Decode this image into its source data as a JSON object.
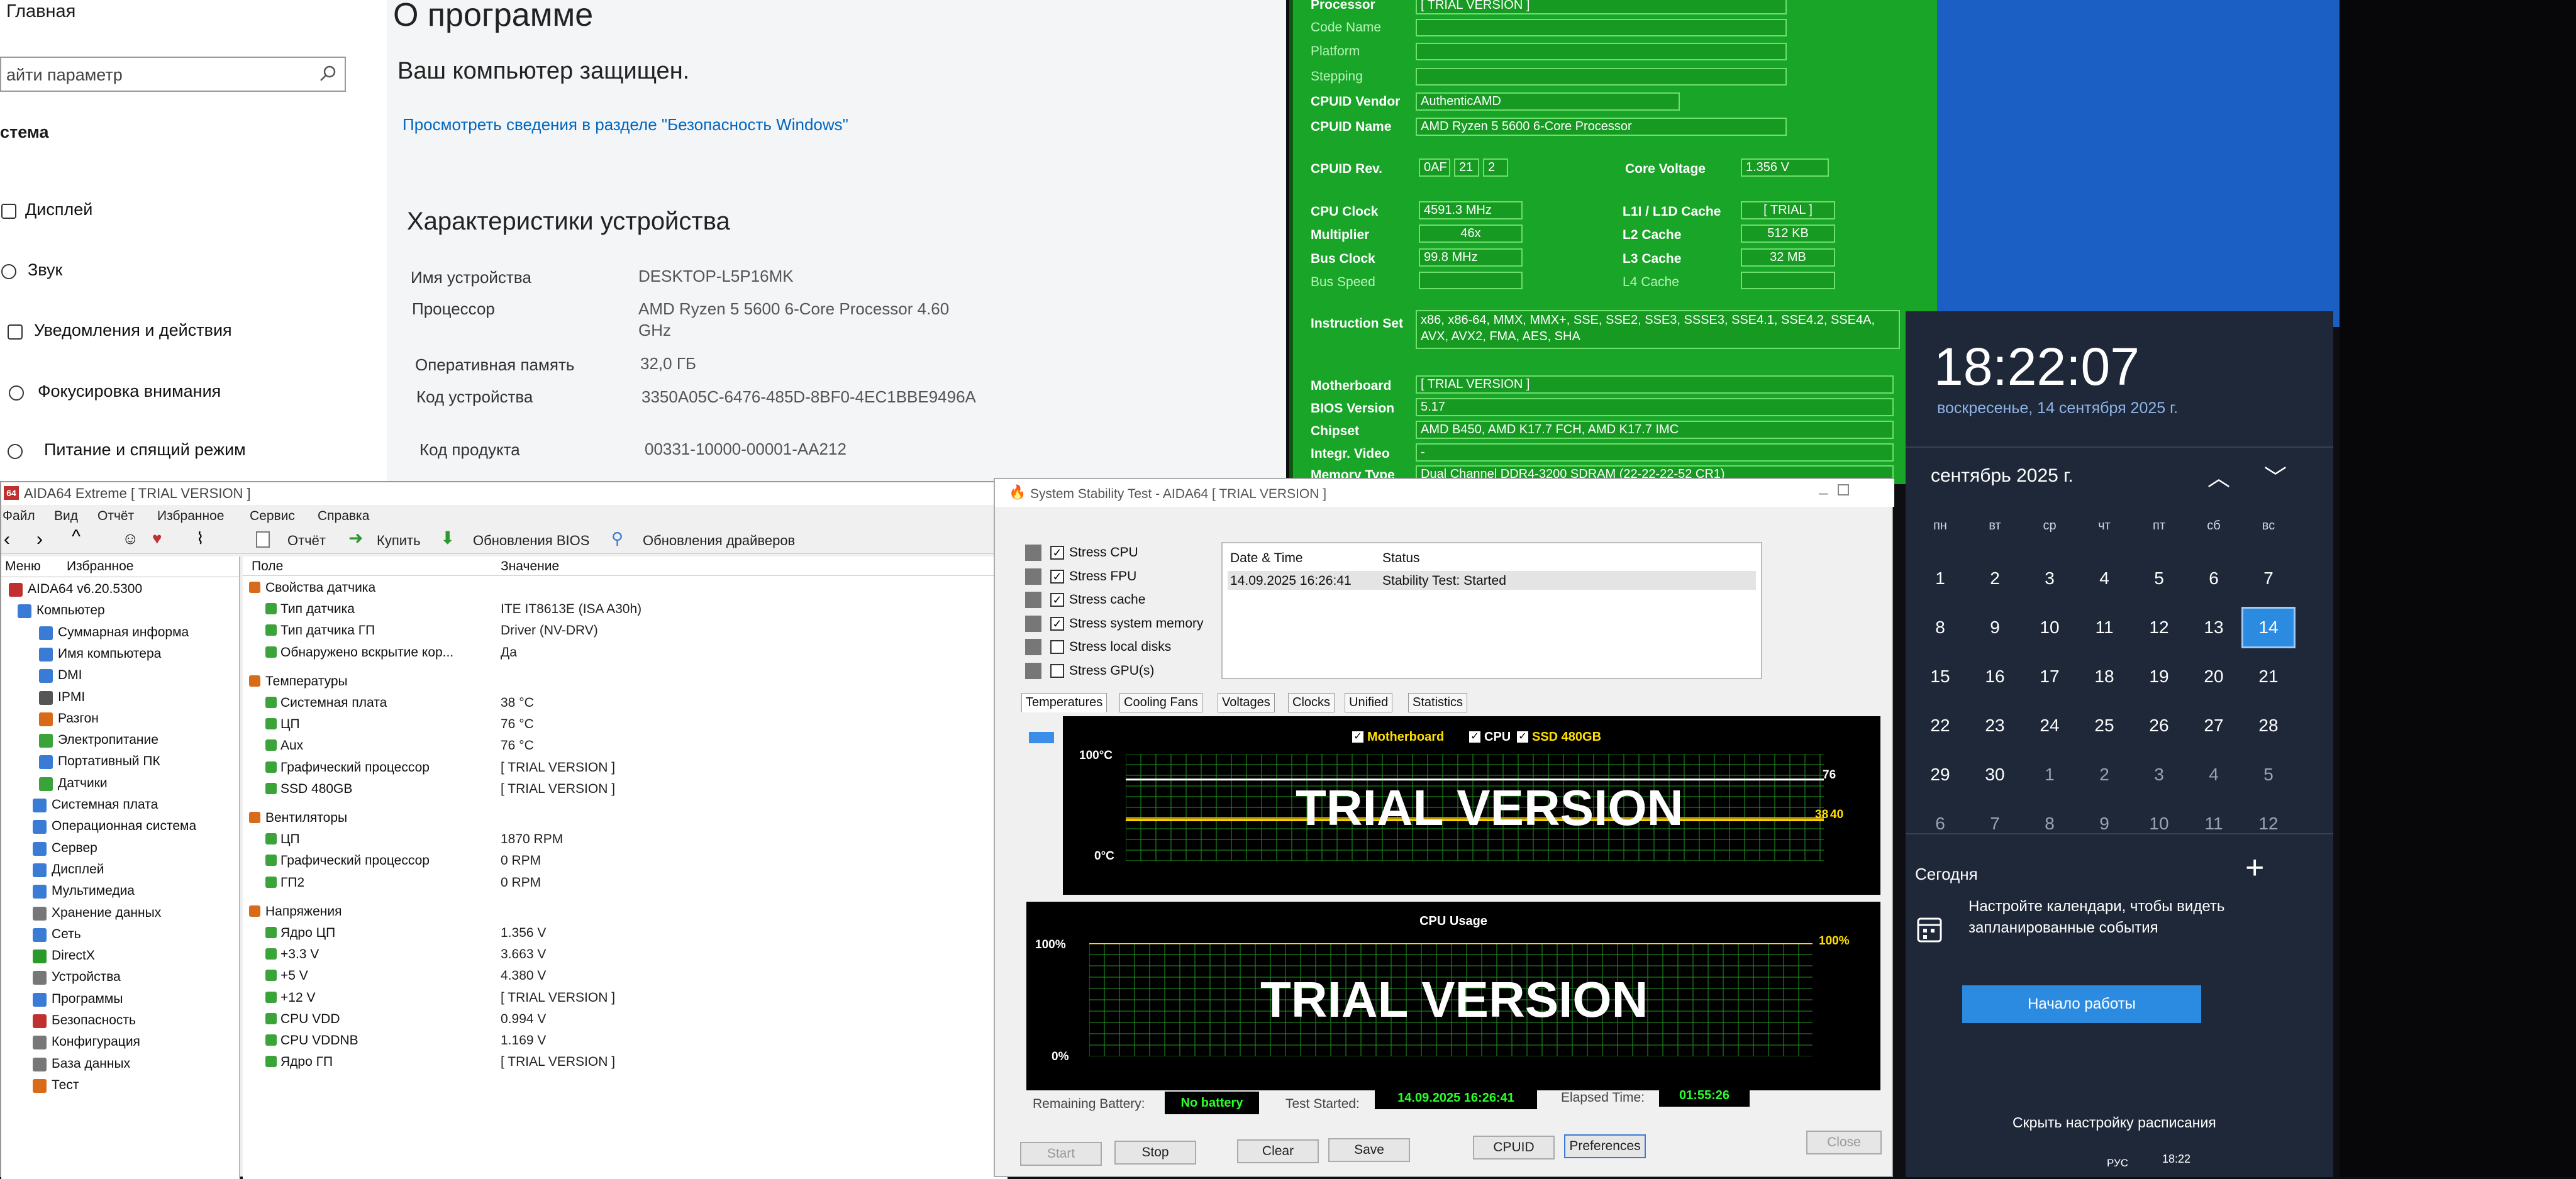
{
  "settings": {
    "nav_home": "Главная",
    "search_placeholder": "айти параметр",
    "section": "стема",
    "nav_items": [
      "Дисплей",
      "Звук",
      "Уведомления и действия",
      "Фокусировка внимания",
      "Питание и спящий режим"
    ],
    "title": "О программе",
    "protected": "Ваш компьютер защищен.",
    "link": "Просмотреть сведения в разделе \"Безопасность Windows\"",
    "specs_title": "Характеристики устройства",
    "specs": [
      {
        "label": "Имя устройства",
        "value": "DESKTOP-L5P16MK"
      },
      {
        "label": "Процессор",
        "value": "AMD Ryzen 5 5600 6-Core Processor 4.60 GHz"
      },
      {
        "label": "Оперативная память",
        "value": "32,0 ГБ"
      },
      {
        "label": "Код устройства",
        "value": "3350A05C-6476-485D-8BF0-4EC1BBE9496A"
      },
      {
        "label": "Код продукта",
        "value": "00331-10000-00001-AA212"
      }
    ]
  },
  "cpuz": {
    "processor_label": "Processor",
    "processor": "[ TRIAL VERSION ]",
    "code_name_label": "Code Name",
    "platform_label": "Platform",
    "stepping_label": "Stepping",
    "vendor_label": "CPUID Vendor",
    "vendor": "AuthenticAMD",
    "name_label": "CPUID Name",
    "name": "AMD Ryzen 5 5600 6-Core Processor",
    "rev_label": "CPUID Rev.",
    "rev": [
      "0AF",
      "21",
      "2"
    ],
    "core_voltage_label": "Core Voltage",
    "core_voltage": "1.356 V",
    "cpu_clock_label": "CPU Clock",
    "cpu_clock": "4591.3 MHz",
    "multiplier_label": "Multiplier",
    "multiplier": "46x",
    "bus_clock_label": "Bus Clock",
    "bus_clock": "99.8 MHz",
    "bus_speed_label": "Bus Speed",
    "l1_label": "L1I / L1D Cache",
    "l1": "[ TRIAL ]",
    "l2_label": "L2 Cache",
    "l2": "512 KB",
    "l3_label": "L3 Cache",
    "l3": "32 MB",
    "l4_label": "L4 Cache",
    "instr_label": "Instruction Set",
    "instr": "x86, x86-64, MMX, MMX+, SSE, SSE2, SSE3, SSSE3, SSE4.1, SSE4.2, SSE4A, AVX, AVX2, FMA, AES, SHA",
    "mb_label": "Motherboard",
    "mb": "[ TRIAL VERSION ]",
    "bios_label": "BIOS Version",
    "bios": "5.17",
    "chipset_label": "Chipset",
    "chipset": "AMD B450, AMD K17.7 FCH, AMD K17.7 IMC",
    "video_label": "Integr. Video",
    "video": "-",
    "mem_label": "Memory Type",
    "mem": "Dual Channel DDR4-3200 SDRAM (22-22-22-52 CR1)"
  },
  "calendar": {
    "time": "18:22:07",
    "date": "воскресенье, 14 сентября 2025 г.",
    "month": "сентябрь 2025 г.",
    "weekdays": [
      "пн",
      "вт",
      "ср",
      "чт",
      "пт",
      "сб",
      "вс"
    ],
    "weeks": [
      [
        "1",
        "2",
        "3",
        "4",
        "5",
        "6",
        "7"
      ],
      [
        "8",
        "9",
        "10",
        "11",
        "12",
        "13",
        "14"
      ],
      [
        "15",
        "16",
        "17",
        "18",
        "19",
        "20",
        "21"
      ],
      [
        "22",
        "23",
        "24",
        "25",
        "26",
        "27",
        "28"
      ],
      [
        "29",
        "30",
        "1",
        "2",
        "3",
        "4",
        "5"
      ],
      [
        "6",
        "7",
        "8",
        "9",
        "10",
        "11",
        "12"
      ]
    ],
    "today_title": "Сегодня",
    "today_text": "Настройте календари, чтобы видеть запланированные события",
    "start_button": "Начало работы",
    "hide_schedule": "Скрыть настройку расписания",
    "tray_lang": "РУС",
    "tray_time": "18:22"
  },
  "aida": {
    "title": "AIDA64 Extreme  [ TRIAL VERSION ]",
    "menu": [
      "Файл",
      "Вид",
      "Отчёт",
      "Избранное",
      "Сервис",
      "Справка"
    ],
    "toolbar": {
      "report": "Отчёт",
      "buy": "Купить",
      "bios": "Обновления BIOS",
      "drivers": "Обновления драйверов"
    },
    "tabs": [
      "Меню",
      "Избранное"
    ],
    "tree": [
      {
        "t": "AIDA64 v6.20.5300",
        "c": "#c03030"
      },
      {
        "t": "Компьютер",
        "c": "#3a7bd5"
      },
      {
        "t": "Суммарная информа",
        "c": "#3a7bd5"
      },
      {
        "t": "Имя компьютера",
        "c": "#3a7bd5"
      },
      {
        "t": "DMI",
        "c": "#3a7bd5"
      },
      {
        "t": "IPMI",
        "c": "#555"
      },
      {
        "t": "Разгон",
        "c": "#d86b1a"
      },
      {
        "t": "Электропитание",
        "c": "#3aa33a"
      },
      {
        "t": "Портативный ПК",
        "c": "#3a7bd5"
      },
      {
        "t": "Датчики",
        "c": "#3aa33a"
      },
      {
        "t": "Системная плата",
        "c": "#3a7bd5"
      },
      {
        "t": "Операционная система",
        "c": "#3a7bd5"
      },
      {
        "t": "Сервер",
        "c": "#3a7bd5"
      },
      {
        "t": "Дисплей",
        "c": "#3a7bd5"
      },
      {
        "t": "Мультимедиа",
        "c": "#3a7bd5"
      },
      {
        "t": "Хранение данных",
        "c": "#777"
      },
      {
        "t": "Сеть",
        "c": "#3a7bd5"
      },
      {
        "t": "DirectX",
        "c": "#2a9a2a"
      },
      {
        "t": "Устройства",
        "c": "#777"
      },
      {
        "t": "Программы",
        "c": "#3a7bd5"
      },
      {
        "t": "Безопасность",
        "c": "#c03030"
      },
      {
        "t": "Конфигурация",
        "c": "#777"
      },
      {
        "t": "База данных",
        "c": "#777"
      },
      {
        "t": "Тест",
        "c": "#d86b1a"
      }
    ],
    "col_field": "Поле",
    "col_value": "Значение",
    "rows": [
      {
        "f": "Свойства датчика",
        "v": "",
        "h": true
      },
      {
        "f": "Тип датчика",
        "v": "ITE IT8613E  (ISA A30h)"
      },
      {
        "f": "Тип датчика ГП",
        "v": "Driver  (NV-DRV)"
      },
      {
        "f": "Обнаружено вскрытие кор...",
        "v": "Да"
      },
      {
        "f": "Температуры",
        "v": "",
        "h": true
      },
      {
        "f": "Системная плата",
        "v": "38 °C"
      },
      {
        "f": "ЦП",
        "v": "76 °C"
      },
      {
        "f": "Aux",
        "v": "76 °C"
      },
      {
        "f": "Графический процессор",
        "v": "[ TRIAL VERSION ]"
      },
      {
        "f": "SSD 480GB",
        "v": "[ TRIAL VERSION ]"
      },
      {
        "f": "Вентиляторы",
        "v": "",
        "h": true
      },
      {
        "f": "ЦП",
        "v": "1870 RPM"
      },
      {
        "f": "Графический процессор",
        "v": "0 RPM"
      },
      {
        "f": "ГП2",
        "v": "0 RPM"
      },
      {
        "f": "Напряжения",
        "v": "",
        "h": true
      },
      {
        "f": "Ядро ЦП",
        "v": "1.356 V"
      },
      {
        "f": "+3.3 V",
        "v": "3.663 V"
      },
      {
        "f": "+5 V",
        "v": "4.380 V"
      },
      {
        "f": "+12 V",
        "v": "[ TRIAL VERSION ]"
      },
      {
        "f": "CPU VDD",
        "v": "0.994 V"
      },
      {
        "f": "CPU VDDNB",
        "v": "1.169 V"
      },
      {
        "f": "Ядро ГП",
        "v": "[ TRIAL VERSION ]"
      }
    ]
  },
  "stability": {
    "title": "System Stability Test - AIDA64  [ TRIAL VERSION ]",
    "checks": [
      {
        "label": "Stress CPU",
        "checked": true
      },
      {
        "label": "Stress FPU",
        "checked": true
      },
      {
        "label": "Stress cache",
        "checked": true
      },
      {
        "label": "Stress system memory",
        "checked": true
      },
      {
        "label": "Stress local disks",
        "checked": false
      },
      {
        "label": "Stress GPU(s)",
        "checked": false
      }
    ],
    "log_headers": [
      "Date & Time",
      "Status"
    ],
    "log_row": [
      "14.09.2025 16:26:41",
      "Stability Test: Started"
    ],
    "tabs": [
      "Temperatures",
      "Cooling Fans",
      "Voltages",
      "Clocks",
      "Unified",
      "Statistics"
    ],
    "legend": [
      "Motherboard",
      "CPU",
      "SSD 480GB"
    ],
    "temp_top": "100°C",
    "temp_bottom": "0°C",
    "temp_vals": [
      "76",
      "38",
      "40"
    ],
    "usage_title": "CPU Usage",
    "usage_top": "100%",
    "usage_bottom": "0%",
    "usage_val": "100%",
    "trial": "TRIAL VERSION",
    "battery_label": "Remaining Battery:",
    "battery": "No battery",
    "started_label": "Test Started:",
    "started": "14.09.2025 16:26:41",
    "elapsed_label": "Elapsed Time:",
    "elapsed": "01:55:26",
    "buttons": [
      "Start",
      "Stop",
      "Clear",
      "Save",
      "CPUID",
      "Preferences",
      "Close"
    ]
  },
  "chart_data": [
    {
      "type": "line",
      "title": "",
      "series": [
        {
          "name": "Motherboard",
          "values": [
            38,
            38,
            38,
            38,
            38
          ]
        },
        {
          "name": "CPU",
          "values": [
            76,
            76,
            76,
            76,
            76
          ]
        },
        {
          "name": "SSD 480GB",
          "values": [
            40,
            40,
            40,
            40,
            40
          ]
        }
      ],
      "ylim": [
        0,
        100
      ]
    },
    {
      "type": "line",
      "title": "CPU Usage",
      "series": [
        {
          "name": "",
          "values": [
            100,
            100,
            100,
            100,
            100
          ]
        }
      ],
      "ylim": [
        0,
        100
      ]
    }
  ],
  "colors": {
    "cpuz_bg": "#18a528",
    "desk": "#1b5fc4",
    "cal_bg": "#1e2838",
    "today": "#2b8be0",
    "graph_grid": "#1f9e1f"
  }
}
